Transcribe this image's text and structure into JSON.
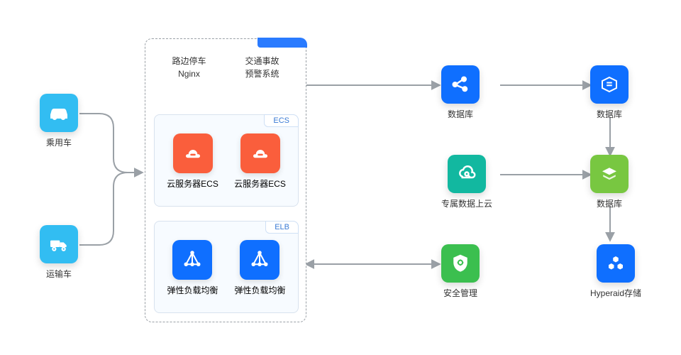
{
  "left": {
    "items": [
      {
        "label": "乘用车"
      },
      {
        "label": "运输车"
      }
    ]
  },
  "center": {
    "head": [
      {
        "line1": "路边停车",
        "line2": "Nginx"
      },
      {
        "line1": "交通事故",
        "line2": "预警系统"
      }
    ],
    "ecs": {
      "badge": "ECS",
      "items": [
        {
          "label": "云服务器ECS"
        },
        {
          "label": "云服务器ECS"
        }
      ]
    },
    "elb": {
      "badge": "ELB",
      "items": [
        {
          "label": "弹性负载均衡"
        },
        {
          "label": "弹性负载均衡"
        }
      ]
    }
  },
  "right": {
    "row1": [
      {
        "label": "数据库"
      },
      {
        "label": "数据库"
      }
    ],
    "row2": [
      {
        "label": "专属数据上云"
      },
      {
        "label": "数据库"
      }
    ],
    "row3": [
      {
        "label": "安全管理"
      },
      {
        "label": "Hyperaid存储"
      }
    ]
  }
}
